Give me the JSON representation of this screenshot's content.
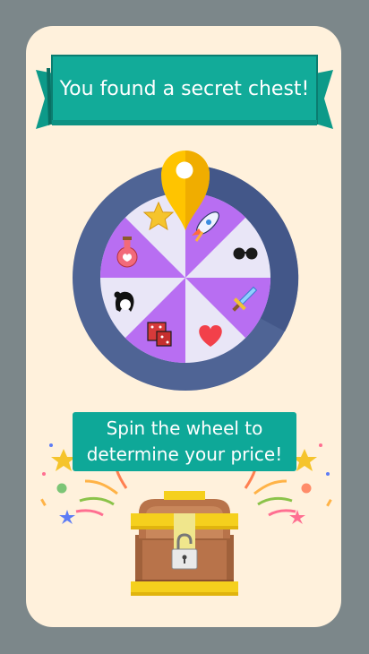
{
  "banner": {
    "title": "You found a secret chest!"
  },
  "message": {
    "line1": "Spin the wheel to",
    "line2": "determine your price!"
  },
  "wheel": {
    "prizes": [
      {
        "name": "rocket-icon"
      },
      {
        "name": "sunglasses-icon"
      },
      {
        "name": "sword-icon"
      },
      {
        "name": "heart-icon"
      },
      {
        "name": "dice-icon"
      },
      {
        "name": "hair-icon"
      },
      {
        "name": "potion-icon"
      },
      {
        "name": "star-icon"
      }
    ],
    "colors": {
      "light": "#e9e6f7",
      "purple": "#b86ef2",
      "rim": "#4f6495",
      "pointer": "#ffc400"
    }
  },
  "colors": {
    "background": "#7c878a",
    "card": "#fff1dc",
    "accent": "#0ea898"
  }
}
